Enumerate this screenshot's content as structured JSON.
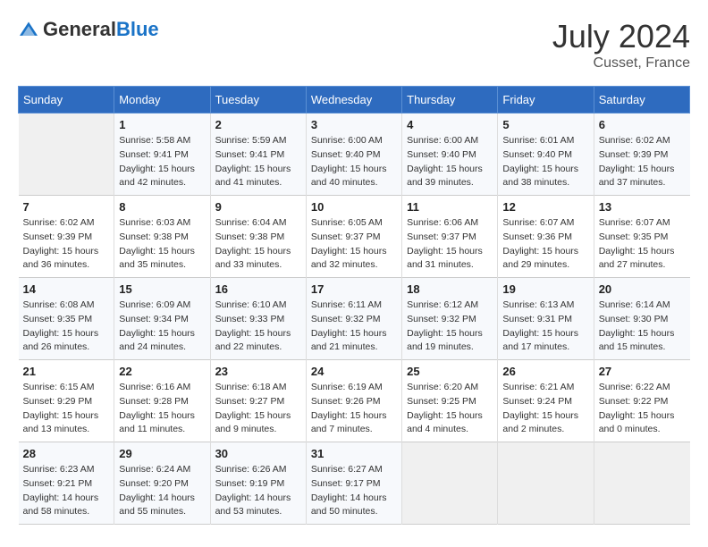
{
  "header": {
    "logo_general": "General",
    "logo_blue": "Blue",
    "month_year": "July 2024",
    "location": "Cusset, France"
  },
  "days_of_week": [
    "Sunday",
    "Monday",
    "Tuesday",
    "Wednesday",
    "Thursday",
    "Friday",
    "Saturday"
  ],
  "weeks": [
    [
      {
        "day": "",
        "info": ""
      },
      {
        "day": "1",
        "info": "Sunrise: 5:58 AM\nSunset: 9:41 PM\nDaylight: 15 hours\nand 42 minutes."
      },
      {
        "day": "2",
        "info": "Sunrise: 5:59 AM\nSunset: 9:41 PM\nDaylight: 15 hours\nand 41 minutes."
      },
      {
        "day": "3",
        "info": "Sunrise: 6:00 AM\nSunset: 9:40 PM\nDaylight: 15 hours\nand 40 minutes."
      },
      {
        "day": "4",
        "info": "Sunrise: 6:00 AM\nSunset: 9:40 PM\nDaylight: 15 hours\nand 39 minutes."
      },
      {
        "day": "5",
        "info": "Sunrise: 6:01 AM\nSunset: 9:40 PM\nDaylight: 15 hours\nand 38 minutes."
      },
      {
        "day": "6",
        "info": "Sunrise: 6:02 AM\nSunset: 9:39 PM\nDaylight: 15 hours\nand 37 minutes."
      }
    ],
    [
      {
        "day": "7",
        "info": "Sunrise: 6:02 AM\nSunset: 9:39 PM\nDaylight: 15 hours\nand 36 minutes."
      },
      {
        "day": "8",
        "info": "Sunrise: 6:03 AM\nSunset: 9:38 PM\nDaylight: 15 hours\nand 35 minutes."
      },
      {
        "day": "9",
        "info": "Sunrise: 6:04 AM\nSunset: 9:38 PM\nDaylight: 15 hours\nand 33 minutes."
      },
      {
        "day": "10",
        "info": "Sunrise: 6:05 AM\nSunset: 9:37 PM\nDaylight: 15 hours\nand 32 minutes."
      },
      {
        "day": "11",
        "info": "Sunrise: 6:06 AM\nSunset: 9:37 PM\nDaylight: 15 hours\nand 31 minutes."
      },
      {
        "day": "12",
        "info": "Sunrise: 6:07 AM\nSunset: 9:36 PM\nDaylight: 15 hours\nand 29 minutes."
      },
      {
        "day": "13",
        "info": "Sunrise: 6:07 AM\nSunset: 9:35 PM\nDaylight: 15 hours\nand 27 minutes."
      }
    ],
    [
      {
        "day": "14",
        "info": "Sunrise: 6:08 AM\nSunset: 9:35 PM\nDaylight: 15 hours\nand 26 minutes."
      },
      {
        "day": "15",
        "info": "Sunrise: 6:09 AM\nSunset: 9:34 PM\nDaylight: 15 hours\nand 24 minutes."
      },
      {
        "day": "16",
        "info": "Sunrise: 6:10 AM\nSunset: 9:33 PM\nDaylight: 15 hours\nand 22 minutes."
      },
      {
        "day": "17",
        "info": "Sunrise: 6:11 AM\nSunset: 9:32 PM\nDaylight: 15 hours\nand 21 minutes."
      },
      {
        "day": "18",
        "info": "Sunrise: 6:12 AM\nSunset: 9:32 PM\nDaylight: 15 hours\nand 19 minutes."
      },
      {
        "day": "19",
        "info": "Sunrise: 6:13 AM\nSunset: 9:31 PM\nDaylight: 15 hours\nand 17 minutes."
      },
      {
        "day": "20",
        "info": "Sunrise: 6:14 AM\nSunset: 9:30 PM\nDaylight: 15 hours\nand 15 minutes."
      }
    ],
    [
      {
        "day": "21",
        "info": "Sunrise: 6:15 AM\nSunset: 9:29 PM\nDaylight: 15 hours\nand 13 minutes."
      },
      {
        "day": "22",
        "info": "Sunrise: 6:16 AM\nSunset: 9:28 PM\nDaylight: 15 hours\nand 11 minutes."
      },
      {
        "day": "23",
        "info": "Sunrise: 6:18 AM\nSunset: 9:27 PM\nDaylight: 15 hours\nand 9 minutes."
      },
      {
        "day": "24",
        "info": "Sunrise: 6:19 AM\nSunset: 9:26 PM\nDaylight: 15 hours\nand 7 minutes."
      },
      {
        "day": "25",
        "info": "Sunrise: 6:20 AM\nSunset: 9:25 PM\nDaylight: 15 hours\nand 4 minutes."
      },
      {
        "day": "26",
        "info": "Sunrise: 6:21 AM\nSunset: 9:24 PM\nDaylight: 15 hours\nand 2 minutes."
      },
      {
        "day": "27",
        "info": "Sunrise: 6:22 AM\nSunset: 9:22 PM\nDaylight: 15 hours\nand 0 minutes."
      }
    ],
    [
      {
        "day": "28",
        "info": "Sunrise: 6:23 AM\nSunset: 9:21 PM\nDaylight: 14 hours\nand 58 minutes."
      },
      {
        "day": "29",
        "info": "Sunrise: 6:24 AM\nSunset: 9:20 PM\nDaylight: 14 hours\nand 55 minutes."
      },
      {
        "day": "30",
        "info": "Sunrise: 6:26 AM\nSunset: 9:19 PM\nDaylight: 14 hours\nand 53 minutes."
      },
      {
        "day": "31",
        "info": "Sunrise: 6:27 AM\nSunset: 9:17 PM\nDaylight: 14 hours\nand 50 minutes."
      },
      {
        "day": "",
        "info": ""
      },
      {
        "day": "",
        "info": ""
      },
      {
        "day": "",
        "info": ""
      }
    ]
  ]
}
